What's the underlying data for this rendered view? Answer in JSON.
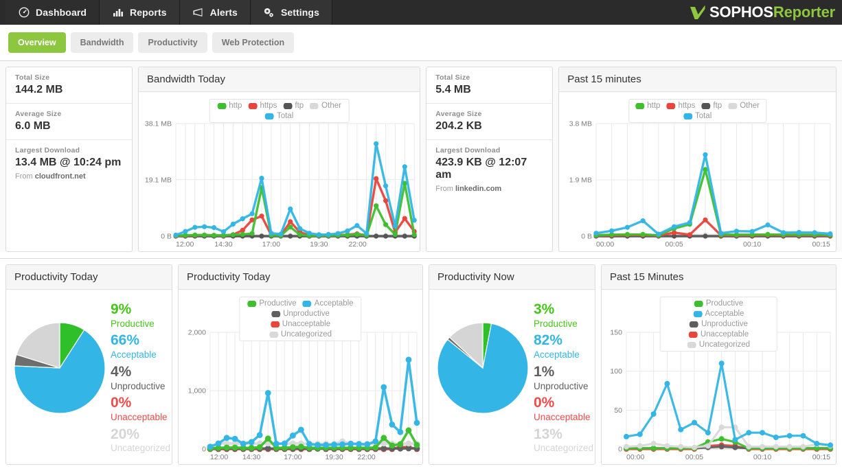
{
  "brand": {
    "name_white": "SOPHOS",
    "name_green": "Reporter",
    "logo_icon": "sophos-check-logo"
  },
  "nav": {
    "items": [
      {
        "label": "Dashboard",
        "icon": "gauge-icon",
        "active": true
      },
      {
        "label": "Reports",
        "icon": "bar-chart-icon",
        "active": false
      },
      {
        "label": "Alerts",
        "icon": "megaphone-icon",
        "active": false
      },
      {
        "label": "Settings",
        "icon": "gears-icon",
        "active": false
      }
    ]
  },
  "subtabs": {
    "items": [
      {
        "label": "Overview",
        "active": true
      },
      {
        "label": "Bandwidth",
        "active": false
      },
      {
        "label": "Productivity",
        "active": false
      },
      {
        "label": "Web Protection",
        "active": false
      }
    ]
  },
  "bandwidth_stats": {
    "total_size_label": "Total Size",
    "total_size_value": "144.2 MB",
    "average_size_label": "Average Size",
    "average_size_value": "6.0 MB",
    "largest_download_label": "Largest Download",
    "largest_download_value": "13.4 MB @ 10:24 pm",
    "from_prefix": "From ",
    "from_host": "cloudfront.net"
  },
  "past15_stats": {
    "total_size_label": "Total Size",
    "total_size_value": "5.4 MB",
    "average_size_label": "Average Size",
    "average_size_value": "204.2 KB",
    "largest_download_label": "Largest Download",
    "largest_download_value": "423.9 KB @ 12:07 am",
    "from_prefix": "From ",
    "from_host": "linkedin.com"
  },
  "panels": {
    "bandwidth_today": "Bandwidth Today",
    "past_15_minutes": "Past 15 minutes",
    "productivity_today_pie": "Productivity Today",
    "productivity_today_chart": "Productivity Today",
    "productivity_now": "Productivity Now",
    "past_15_minutes_caps": "Past 15 Minutes"
  },
  "colors": {
    "http": "#3fbf2f",
    "https": "#e8453c",
    "ftp": "#555555",
    "other": "#d9d9d9",
    "total": "#33b5e5",
    "productive": "#3fbf2f",
    "acceptable": "#33b5e5",
    "unproductive": "#5f5f5f",
    "unacceptable": "#e8453c",
    "uncategorized": "#d9d9d9",
    "accent_green": "#8dc63f",
    "topbar": "#2b2b2b"
  },
  "productivity_today_pie": {
    "items": [
      {
        "pct": "9%",
        "label": "Productive",
        "color": "#2fbf28",
        "value": 9
      },
      {
        "pct": "66%",
        "label": "Acceptable",
        "color": "#33b5e5",
        "value": 66
      },
      {
        "pct": "4%",
        "label": "Unproductive",
        "color": "#6e6e6e",
        "value": 4
      },
      {
        "pct": "0%",
        "label": "Unacceptable",
        "color": "#e8453c",
        "value": 0
      },
      {
        "pct": "20%",
        "label": "Uncategorized",
        "color": "#d5d5d5",
        "value": 20
      }
    ]
  },
  "productivity_now_pie": {
    "items": [
      {
        "pct": "3%",
        "label": "Productive",
        "color": "#2fbf28",
        "value": 3
      },
      {
        "pct": "82%",
        "label": "Acceptable",
        "color": "#33b5e5",
        "value": 82
      },
      {
        "pct": "1%",
        "label": "Unproductive",
        "color": "#6e6e6e",
        "value": 1
      },
      {
        "pct": "0%",
        "label": "Unacceptable",
        "color": "#e8453c",
        "value": 0
      },
      {
        "pct": "13%",
        "label": "Uncategorized",
        "color": "#d5d5d5",
        "value": 13
      }
    ]
  },
  "chart_data": [
    {
      "id": "bandwidth_today",
      "type": "line",
      "title": "Bandwidth Today",
      "xlabel": "",
      "ylabel": "",
      "ylim": [
        0,
        38.1
      ],
      "ytick_labels": [
        "38.1 MB",
        "19.1 MB",
        "0 B"
      ],
      "ytick_values": [
        38.1,
        19.1,
        0
      ],
      "xtick_labels": [
        "12:00",
        "14:30",
        "17:00",
        "19:30",
        "22:00"
      ],
      "xtick_positions": [
        0,
        5,
        10,
        15,
        20
      ],
      "grid": true,
      "legend": [
        "http",
        "https",
        "ftp",
        "Other",
        "Total"
      ],
      "legend_position": "top-center",
      "x": [
        0,
        1,
        2,
        3,
        4,
        5,
        6,
        7,
        8,
        9,
        10,
        11,
        12,
        13,
        14,
        15,
        16,
        17,
        18,
        19,
        20,
        21,
        22,
        23,
        24,
        25
      ],
      "series": [
        {
          "name": "Total",
          "color": "#33b5e5",
          "values": [
            0.4,
            1.6,
            3.0,
            3.2,
            2.9,
            1.5,
            4.1,
            5.9,
            7.6,
            19.6,
            1.0,
            0.7,
            9.2,
            2.6,
            1.0,
            0.5,
            0.6,
            0.9,
            1.8,
            3.6,
            0.9,
            31.3,
            17.0,
            3.4,
            23.5,
            5.4
          ]
        },
        {
          "name": "http",
          "color": "#3fbf2f",
          "values": [
            0.2,
            0.3,
            0.4,
            0.4,
            0.3,
            0.3,
            0.5,
            0.6,
            0.9,
            16.4,
            0.3,
            0.2,
            3.1,
            0.5,
            0.2,
            0.2,
            0.2,
            0.3,
            0.4,
            0.6,
            0.3,
            10.3,
            3.9,
            0.6,
            17.9,
            0.5
          ]
        },
        {
          "name": "https",
          "color": "#e8453c",
          "values": [
            0.1,
            0.2,
            0.3,
            0.4,
            0.3,
            0.2,
            0.5,
            2.0,
            5.5,
            6.8,
            0.4,
            0.2,
            4.9,
            1.4,
            0.3,
            0.2,
            0.2,
            0.3,
            0.5,
            0.8,
            0.3,
            19.5,
            12.0,
            1.3,
            6.0,
            1.6
          ]
        },
        {
          "name": "ftp",
          "color": "#555555",
          "values": [
            0,
            0,
            0,
            0,
            0,
            0,
            0,
            0,
            0,
            0,
            0,
            0,
            0,
            0,
            0,
            0,
            0,
            0,
            0,
            0,
            0,
            0,
            0,
            0,
            0,
            0
          ]
        },
        {
          "name": "Other",
          "color": "#d9d9d9",
          "values": [
            0.1,
            0.2,
            0.2,
            0.2,
            0.2,
            0.2,
            0.2,
            0.2,
            0.2,
            0.2,
            0.2,
            0.2,
            0.2,
            0.2,
            0.2,
            0.2,
            0.2,
            0.2,
            0.2,
            0.2,
            0.2,
            0.2,
            0.2,
            0.2,
            0.2,
            0.2
          ]
        }
      ]
    },
    {
      "id": "bandwidth_past_15_minutes",
      "type": "line",
      "title": "Past 15 minutes",
      "xlabel": "",
      "ylabel": "",
      "ylim": [
        0,
        3.8
      ],
      "ytick_labels": [
        "3.8 MB",
        "1.9 MB",
        "0 B"
      ],
      "ytick_values": [
        3.8,
        1.9,
        0
      ],
      "xtick_labels": [
        "00:00",
        "00:05",
        "00:10",
        "00:15"
      ],
      "xtick_positions": [
        0,
        5,
        10,
        15
      ],
      "grid": true,
      "legend": [
        "http",
        "https",
        "ftp",
        "Other",
        "Total"
      ],
      "legend_position": "top-center",
      "x": [
        0,
        1,
        2,
        3,
        4,
        5,
        6,
        7,
        8,
        9,
        10,
        11,
        12,
        13,
        14,
        15
      ],
      "series": [
        {
          "name": "Total",
          "color": "#33b5e5",
          "values": [
            0.1,
            0.18,
            0.3,
            0.52,
            0.07,
            0.32,
            0.46,
            2.75,
            0.1,
            0.17,
            0.16,
            0.38,
            0.12,
            0.13,
            0.12,
            0.08
          ]
        },
        {
          "name": "http",
          "color": "#3fbf2f",
          "values": [
            0.03,
            0.05,
            0.06,
            0.06,
            0.03,
            0.26,
            0.4,
            2.25,
            0.05,
            0.05,
            0.05,
            0.06,
            0.05,
            0.05,
            0.05,
            0.04
          ]
        },
        {
          "name": "https",
          "color": "#e8453c",
          "values": [
            0.02,
            0.03,
            0.04,
            0.04,
            0.02,
            0.12,
            0.05,
            0.55,
            0.03,
            0.03,
            0.03,
            0.04,
            0.03,
            0.03,
            0.03,
            0.02
          ]
        },
        {
          "name": "ftp",
          "color": "#555555",
          "values": [
            0,
            0,
            0,
            0,
            0,
            0,
            0,
            0,
            0,
            0,
            0,
            0,
            0,
            0,
            0,
            0
          ]
        },
        {
          "name": "Other",
          "color": "#d9d9d9",
          "values": [
            0.04,
            0.04,
            0.04,
            0.04,
            0.04,
            0.04,
            0.04,
            0.04,
            0.04,
            0.04,
            0.04,
            0.04,
            0.04,
            0.04,
            0.04,
            0.04
          ]
        }
      ]
    },
    {
      "id": "productivity_today",
      "type": "line",
      "title": "Productivity Today",
      "xlabel": "",
      "ylabel": "",
      "ylim": [
        0,
        2000
      ],
      "ytick_labels": [
        "2,000",
        "1,000",
        "0"
      ],
      "ytick_values": [
        2000,
        1000,
        0
      ],
      "xtick_labels": [
        "12:00",
        "14:30",
        "17:00",
        "19:30",
        "22:00"
      ],
      "xtick_positions": [
        0,
        5,
        10,
        15,
        20
      ],
      "grid": true,
      "legend": [
        "Productive",
        "Acceptable",
        "Unproductive",
        "Unacceptable",
        "Uncategorized"
      ],
      "legend_position": "top-center",
      "x": [
        0,
        1,
        2,
        3,
        4,
        5,
        6,
        7,
        8,
        9,
        10,
        11,
        12,
        13,
        14,
        15,
        16,
        17,
        18,
        19,
        20,
        21,
        22,
        23,
        24,
        25
      ],
      "series": [
        {
          "name": "Acceptable",
          "color": "#33b5e5",
          "values": [
            40,
            95,
            190,
            175,
            90,
            120,
            240,
            960,
            90,
            95,
            230,
            330,
            85,
            70,
            70,
            75,
            80,
            90,
            85,
            80,
            130,
            1060,
            420,
            290,
            1530,
            450
          ]
        },
        {
          "name": "Productive",
          "color": "#3fbf2f",
          "values": [
            10,
            20,
            25,
            25,
            20,
            20,
            30,
            180,
            20,
            20,
            30,
            40,
            20,
            20,
            20,
            20,
            20,
            20,
            20,
            20,
            25,
            190,
            60,
            80,
            320,
            70
          ]
        },
        {
          "name": "Uncategorized",
          "color": "#d9d9d9",
          "values": [
            35,
            95,
            95,
            95,
            90,
            90,
            95,
            95,
            90,
            90,
            95,
            95,
            90,
            90,
            90,
            90,
            130,
            95,
            90,
            90,
            95,
            95,
            90,
            90,
            95,
            90
          ]
        },
        {
          "name": "Unproductive",
          "color": "#5f5f5f",
          "values": [
            5,
            8,
            8,
            8,
            6,
            6,
            8,
            10,
            6,
            6,
            8,
            8,
            6,
            6,
            6,
            6,
            8,
            8,
            6,
            6,
            8,
            10,
            8,
            8,
            12,
            8
          ]
        },
        {
          "name": "Unacceptable",
          "color": "#e8453c",
          "values": [
            0,
            0,
            0,
            0,
            0,
            0,
            0,
            0,
            0,
            0,
            0,
            0,
            0,
            25,
            0,
            0,
            0,
            0,
            0,
            0,
            0,
            0,
            0,
            35,
            30,
            0
          ]
        }
      ]
    },
    {
      "id": "productivity_past_15_minutes",
      "type": "line",
      "title": "Past 15 Minutes",
      "xlabel": "",
      "ylabel": "",
      "ylim": [
        0,
        150
      ],
      "ytick_labels": [
        "150",
        "100",
        "50",
        "0"
      ],
      "ytick_values": [
        150,
        100,
        50,
        0
      ],
      "xtick_labels": [
        "00:00",
        "00:05",
        "00:10",
        "00:15"
      ],
      "xtick_positions": [
        0,
        5,
        10,
        15
      ],
      "grid": true,
      "legend": [
        "Productive",
        "Acceptable",
        "Unproductive",
        "Unacceptable",
        "Uncategorized"
      ],
      "legend_position": "top-center",
      "x": [
        0,
        1,
        2,
        3,
        4,
        5,
        6,
        7,
        8,
        9,
        10,
        11,
        12,
        13,
        14,
        15
      ],
      "series": [
        {
          "name": "Acceptable",
          "color": "#33b5e5",
          "values": [
            16,
            19,
            45,
            84,
            25,
            34,
            21,
            110,
            12,
            21,
            21,
            15,
            17,
            17,
            7,
            5
          ]
        },
        {
          "name": "Uncategorized",
          "color": "#d9d9d9",
          "values": [
            3,
            4,
            7,
            4,
            3,
            2,
            4,
            28,
            28,
            3,
            3,
            3,
            3,
            3,
            6,
            4
          ]
        },
        {
          "name": "Productive",
          "color": "#3fbf2f",
          "values": [
            1,
            1,
            1,
            1,
            1,
            1,
            9,
            13,
            9,
            1,
            1,
            1,
            1,
            1,
            1,
            1
          ]
        },
        {
          "name": "Unproductive",
          "color": "#5f5f5f",
          "values": [
            1,
            1,
            1,
            1,
            1,
            1,
            2,
            3,
            2,
            1,
            1,
            1,
            1,
            1,
            1,
            1
          ]
        },
        {
          "name": "Unacceptable",
          "color": "#e8453c",
          "values": [
            0,
            0,
            0,
            0,
            0,
            0,
            4,
            5,
            4,
            0,
            0,
            0,
            0,
            0,
            0,
            0
          ]
        }
      ]
    }
  ]
}
